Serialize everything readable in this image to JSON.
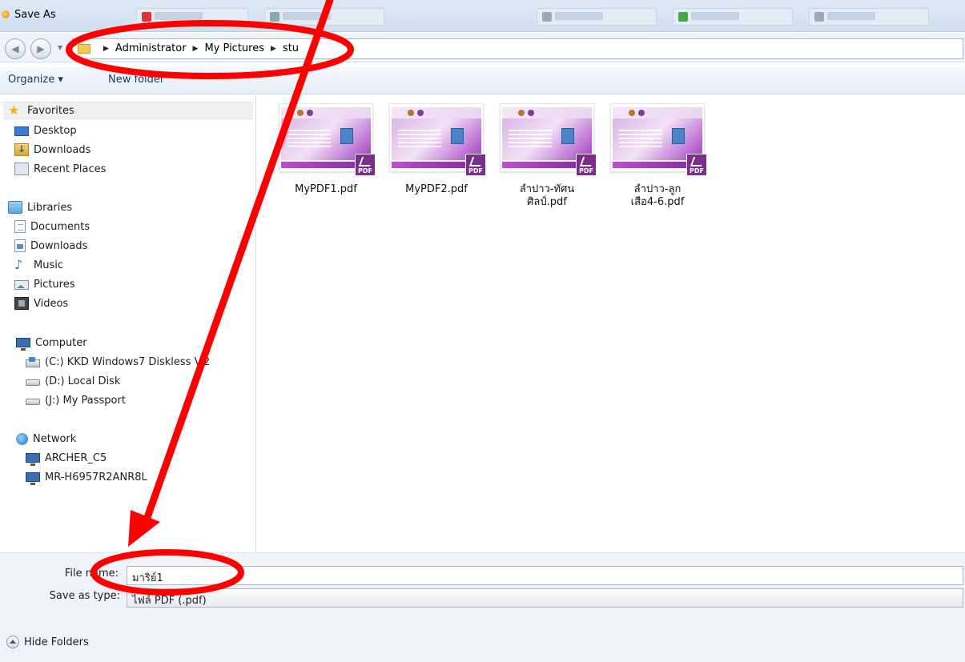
{
  "window": {
    "title": "Save As"
  },
  "address": {
    "crumbs": [
      "Administrator",
      "My Pictures",
      "stu"
    ]
  },
  "toolbar": {
    "organize": "Organize ▾",
    "new_folder": "New folder"
  },
  "sidebar": {
    "favorites": {
      "label": "Favorites",
      "items": [
        "Desktop",
        "Downloads",
        "Recent Places"
      ]
    },
    "libraries": {
      "label": "Libraries",
      "items": [
        "Documents",
        "Downloads",
        "Music",
        "Pictures",
        "Videos"
      ]
    },
    "computer": {
      "label": "Computer",
      "items": [
        "(C:) KKD Windows7 Diskless V.2",
        "(D:) Local Disk",
        "(J:) My Passport"
      ]
    },
    "network": {
      "label": "Network",
      "items": [
        "ARCHER_C5",
        "MR-H6957R2ANR8L"
      ]
    }
  },
  "files": [
    {
      "line1": "MyPDF1.pdf",
      "line2": ""
    },
    {
      "line1": "MyPDF2.pdf",
      "line2": ""
    },
    {
      "line1": "ลำปาว-ทัศน",
      "line2": "ศิลป์.pdf"
    },
    {
      "line1": "ลำปาว-ลูก",
      "line2": "เสือ4-6.pdf"
    }
  ],
  "form": {
    "filename_label": "File name:",
    "filename_value": "มาริย์1",
    "type_label": "Save as type:",
    "type_value": "ไฟล์ PDF (.pdf)"
  },
  "hide_folders": "Hide Folders",
  "colors": {
    "annotation": "#ff0000",
    "pdf_badge": "#7a2d8c",
    "window_frame": "#cfdff0"
  }
}
